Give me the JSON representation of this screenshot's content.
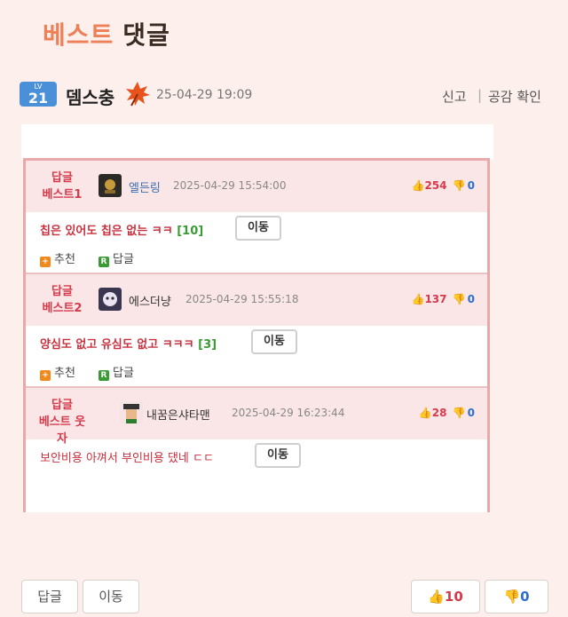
{
  "header": {
    "title_part1": "베스트",
    "title_part2": "댓글"
  },
  "author": {
    "level_label": "LV",
    "level": "21",
    "nickname": "뎀스충",
    "icon": "maple-leaf-icon",
    "time": "25-04-29 19:09",
    "report_label": "신고",
    "separator": "|",
    "like_check_label": "공감 확인"
  },
  "screenshot": {
    "replies": [
      {
        "best_line1": "답글",
        "best_line2": "베스트1",
        "username": "엘든링",
        "date": "2025-04-29 15:54:00",
        "up": "254",
        "down": "0",
        "text": "칩은 있어도 칩은 없는 ㅋㅋ",
        "count": "[10]",
        "move_label": "이동",
        "recommend_label": "추천",
        "reply_label": "답글"
      },
      {
        "best_line1": "답글",
        "best_line2": "베스트2",
        "username": "에스더냥",
        "date": "2025-04-29 15:55:18",
        "up": "137",
        "down": "0",
        "text": "양심도 없고 유심도 없고 ㅋㅋㅋ",
        "count": "[3]",
        "move_label": "이동",
        "recommend_label": "추천",
        "reply_label": "답글"
      },
      {
        "best_line1": "답글",
        "best_line2": "베스트 웃자",
        "username": "내꿈은샤타맨",
        "date": "2025-04-29 16:23:44",
        "up": "28",
        "down": "0",
        "text": "보안비용 아껴서 부인비용 댔네 ㄷㄷ",
        "move_label": "이동"
      }
    ]
  },
  "footer": {
    "reply_button": "답글",
    "move_button": "이동",
    "upvote_count": "10",
    "downvote_count": "0"
  },
  "colors": {
    "background": "#fcefec",
    "accent_red": "#d53a4b",
    "accent_blue": "#2b6fd1",
    "title_orange": "#ee8058"
  }
}
